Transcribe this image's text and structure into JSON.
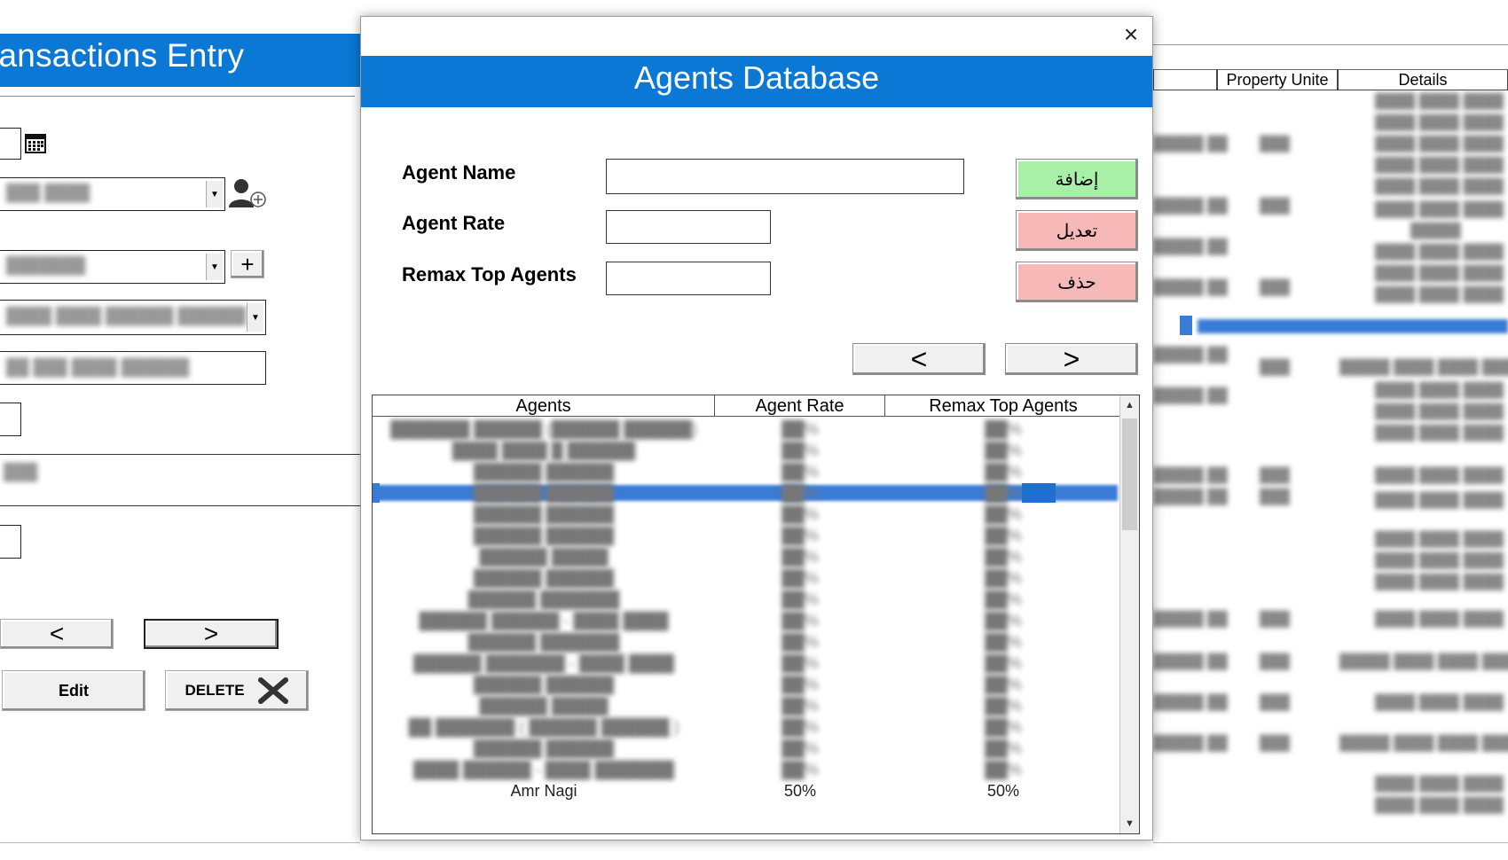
{
  "background_form": {
    "title": "ransactions Entry",
    "prev_label": "<",
    "next_label": ">",
    "edit_label": "Edit",
    "delete_label": "DELETE"
  },
  "background_sheet": {
    "headers": [
      "Property Unite",
      "Details"
    ]
  },
  "modal": {
    "title": "Agents Database",
    "close_label": "×",
    "fields": {
      "agent_name_label": "Agent Name",
      "agent_rate_label": "Agent Rate",
      "top_agents_label": "Remax Top Agents",
      "agent_name_value": "",
      "agent_rate_value": "",
      "top_agents_value": ""
    },
    "actions": {
      "add_label": "إضافة",
      "edit_label": "تعديل",
      "delete_label": "حذف",
      "add_color": "#a8f0a8",
      "edit_color": "#f7b8b8",
      "delete_color": "#f7b8b8"
    },
    "nav": {
      "prev_label": "<",
      "next_label": ">"
    },
    "list": {
      "columns": [
        "Agents",
        "Agent Rate",
        "Remax Top Agents"
      ],
      "rows": [
        [
          "███████ ██████ (██████ ██████)",
          "██%",
          "██%"
        ],
        [
          "████ ████ █ ██████",
          "██%",
          "██%"
        ],
        [
          "██████ ██████",
          "██%",
          "██%"
        ],
        [
          "██████ ██████",
          "██%",
          "██%"
        ],
        [
          "██████ ██████",
          "██%",
          "██%"
        ],
        [
          "██████ ██████",
          "██%",
          "██%"
        ],
        [
          "██████ █████",
          "██%",
          "██%"
        ],
        [
          "██████ ██████",
          "██%",
          "██%"
        ],
        [
          "██████ ███████",
          "██%",
          "██%"
        ],
        [
          "██████ ██████ - ████ ████",
          "██%",
          "██%"
        ],
        [
          "██████ ███████",
          "██%",
          "██%"
        ],
        [
          "██████ ███████ - ████ ████",
          "██%",
          "██%"
        ],
        [
          "██████ ██████",
          "██%",
          "██%"
        ],
        [
          "██████ █████",
          "██%",
          "██%"
        ],
        [
          "██ ███████ ( ██████ ██████ )",
          "██%",
          "██%"
        ],
        [
          "██████ ██████",
          "██%",
          "██%"
        ],
        [
          "████ ██████ - ████ ███████",
          "██%",
          "██%"
        ],
        [
          "Amr Nagi",
          "50%",
          "50%"
        ]
      ],
      "selected_index": 3,
      "selection_color": "#3a7bd5"
    }
  },
  "colors": {
    "banner": "#0a78d4"
  }
}
